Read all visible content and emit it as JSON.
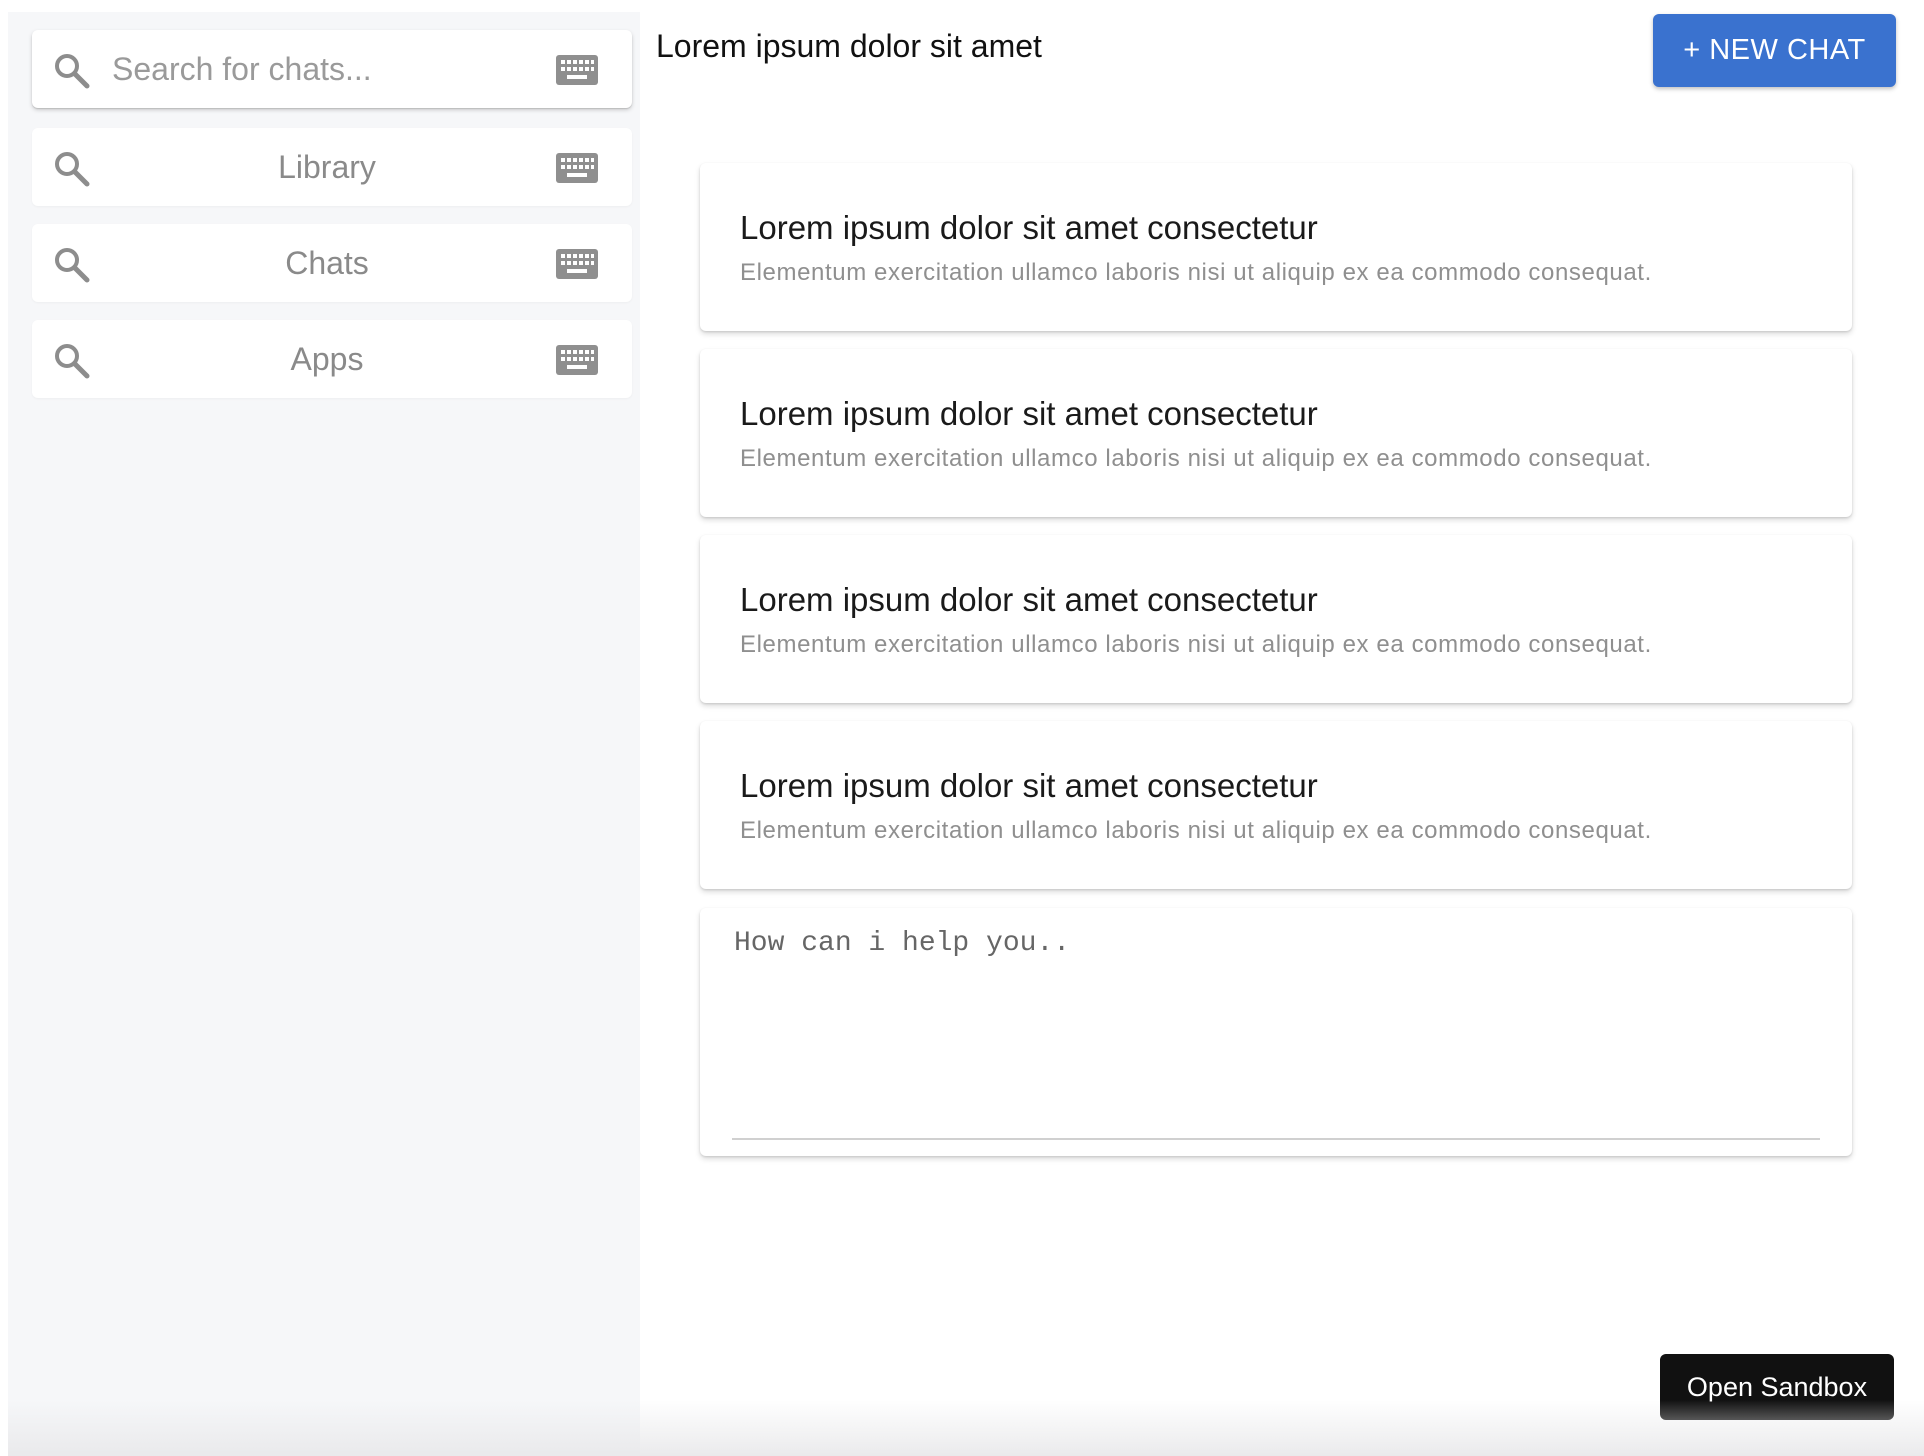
{
  "sidebar": {
    "search": {
      "placeholder": "Search for chats..."
    },
    "items": [
      {
        "label": "Library"
      },
      {
        "label": "Chats"
      },
      {
        "label": "Apps"
      }
    ]
  },
  "header": {
    "title": "Lorem ipsum dolor sit amet",
    "new_chat_label": "+ NEW CHAT"
  },
  "chats": [
    {
      "title": "Lorem ipsum dolor sit amet consectetur",
      "subtitle": "Elementum exercitation ullamco laboris nisi ut aliquip ex ea commodo consequat."
    },
    {
      "title": "Lorem ipsum dolor sit amet consectetur",
      "subtitle": "Elementum exercitation ullamco laboris nisi ut aliquip ex ea commodo consequat."
    },
    {
      "title": "Lorem ipsum dolor sit amet consectetur",
      "subtitle": "Elementum exercitation ullamco laboris nisi ut aliquip ex ea commodo consequat."
    },
    {
      "title": "Lorem ipsum dolor sit amet consectetur",
      "subtitle": "Elementum exercitation ullamco laboris nisi ut aliquip ex ea commodo consequat."
    }
  ],
  "composer": {
    "placeholder": "How can i help you.."
  },
  "footer": {
    "sandbox_label": "Open Sandbox"
  },
  "colors": {
    "accent": "#3a72cf",
    "sidebar_bg": "#f6f7f9",
    "sandbox_bg": "#111111"
  },
  "icons": {
    "search": "search-icon",
    "keyboard": "keyboard-icon"
  }
}
